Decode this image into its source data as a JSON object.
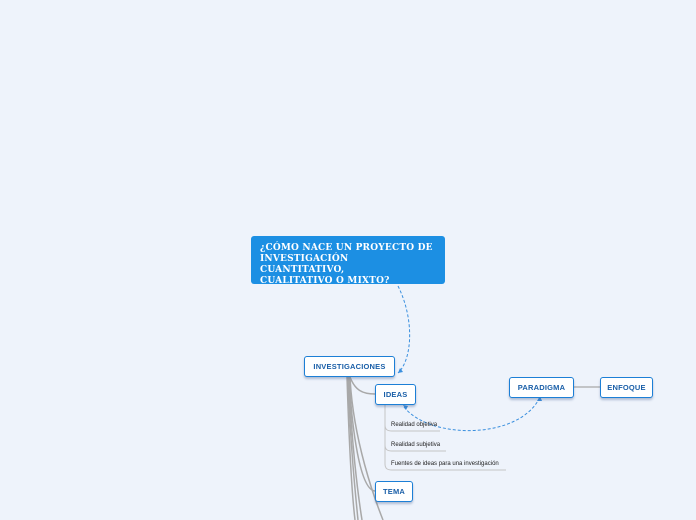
{
  "root": {
    "title_line1": "¿CÓMO NACE UN PROYECTO DE",
    "title_line2": "INVESTIGACIÓN CUANTITATIVO,",
    "title_line3": "CUALITATIVO O MIXTO?"
  },
  "topics": {
    "investigaciones": "INVESTIGACIONES",
    "ideas": "IDEAS",
    "tema": "TEMA",
    "paradigma": "PARADIGMA",
    "enfoque": "ENFOQUE"
  },
  "subtopics": [
    "Realidad objetiva",
    "Realidad subjetiva",
    "Fuentes de ideas para una investigación"
  ],
  "colors": {
    "background": "#eef3fb",
    "root_fill": "#1c8fe3",
    "topic_border": "#1c7fd6",
    "topic_text": "#1a5fa8",
    "connector": "#a8a8a8",
    "dashed_link": "#3a8fde"
  }
}
